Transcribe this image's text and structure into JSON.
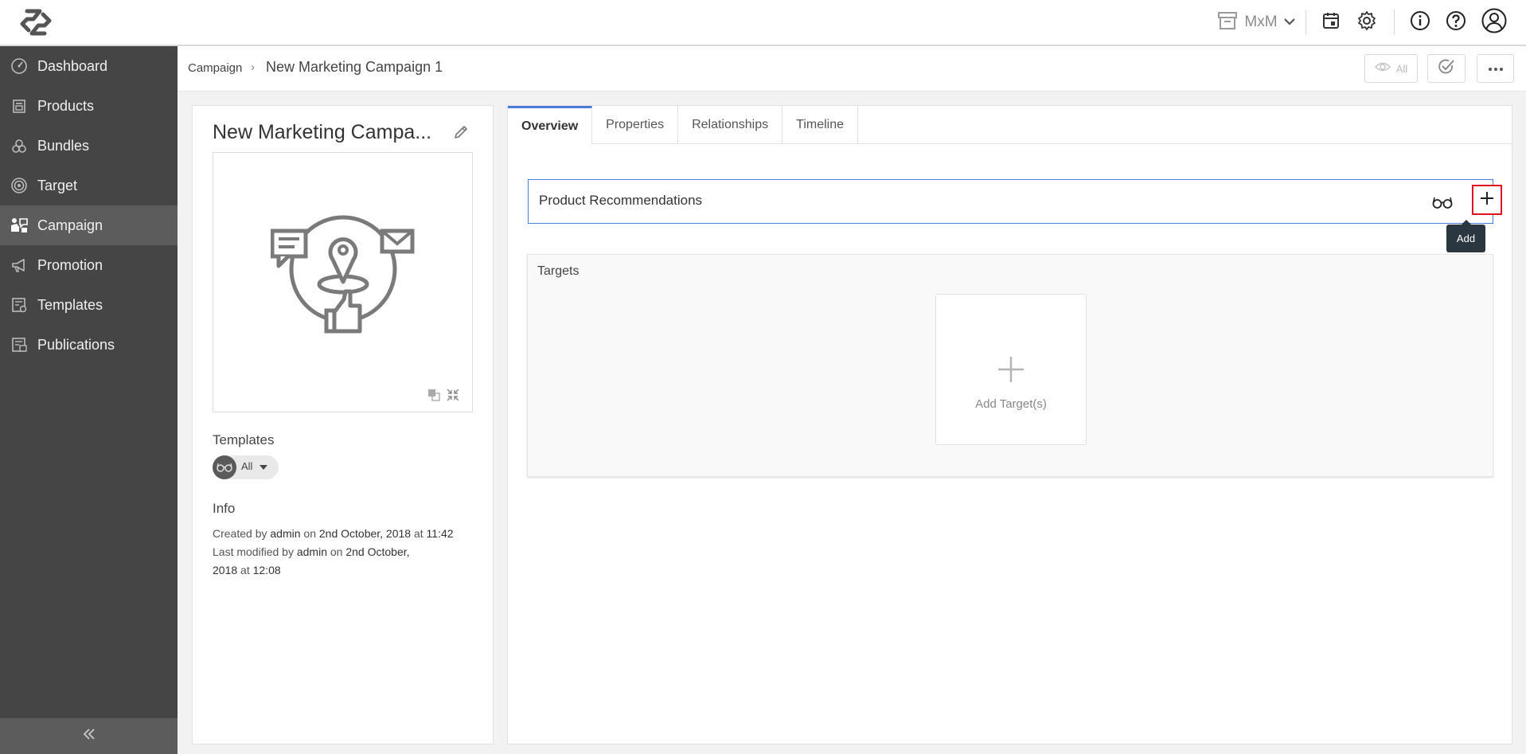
{
  "topbar": {
    "env_label": "MxM"
  },
  "sidebar": {
    "items": [
      {
        "label": "Dashboard",
        "icon": "dashboard-icon"
      },
      {
        "label": "Products",
        "icon": "products-icon"
      },
      {
        "label": "Bundles",
        "icon": "bundles-icon"
      },
      {
        "label": "Target",
        "icon": "target-icon"
      },
      {
        "label": "Campaign",
        "icon": "campaign-icon",
        "active": true
      },
      {
        "label": "Promotion",
        "icon": "megaphone-icon"
      },
      {
        "label": "Templates",
        "icon": "templates-icon"
      },
      {
        "label": "Publications",
        "icon": "publications-icon"
      }
    ]
  },
  "breadcrumb": {
    "root": "Campaign",
    "separator": "›",
    "current": "New Marketing Campaign 1"
  },
  "header_actions": {
    "view_filter_label": "All"
  },
  "entity": {
    "title": "New Marketing Campa...",
    "templates_heading": "Templates",
    "templates_selected": "All",
    "info_heading": "Info",
    "created": {
      "prefix": "Created by",
      "user": "admin",
      "on": "on",
      "date": "2nd October, 2018",
      "at": "at",
      "time": "11:42"
    },
    "modified": {
      "prefix": "Last modified by",
      "user": "admin",
      "on": "on",
      "date_part1": "2nd October,",
      "date_part2": "2018",
      "at": "at",
      "time": "12:08"
    }
  },
  "tabs": [
    {
      "label": "Overview",
      "active": true
    },
    {
      "label": "Properties"
    },
    {
      "label": "Relationships"
    },
    {
      "label": "Timeline"
    }
  ],
  "overview": {
    "product_recommendations": "Product Recommendations",
    "add_tooltip": "Add",
    "targets_heading": "Targets",
    "add_targets_label": "Add Target(s)"
  },
  "colors": {
    "accent": "#4a7bd6",
    "sidebar_bg": "#454545",
    "sidebar_active": "#5c5c5c",
    "highlight_border": "#e0141e",
    "tooltip_bg": "#2a3640"
  }
}
